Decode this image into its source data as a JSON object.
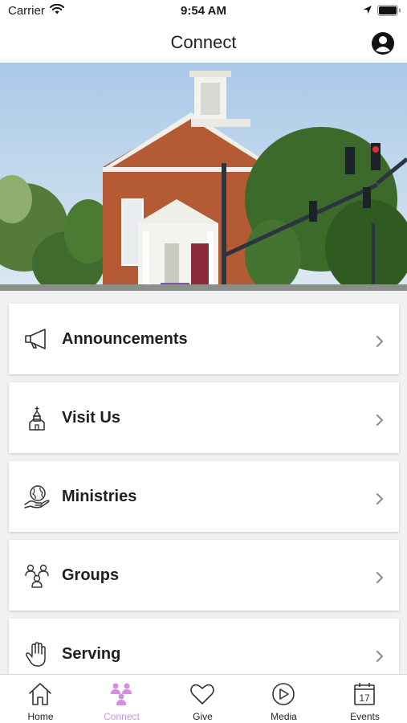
{
  "status_bar": {
    "carrier": "Carrier",
    "time": "9:54 AM"
  },
  "header": {
    "title": "Connect"
  },
  "menu": [
    {
      "label": "Announcements",
      "icon": "megaphone-icon"
    },
    {
      "label": "Visit Us",
      "icon": "church-icon"
    },
    {
      "label": "Ministries",
      "icon": "globe-hand-icon"
    },
    {
      "label": "Groups",
      "icon": "people-group-icon"
    },
    {
      "label": "Serving",
      "icon": "hand-icon"
    }
  ],
  "tabs": [
    {
      "label": "Home",
      "icon": "home-icon"
    },
    {
      "label": "Connect",
      "icon": "connect-people-icon",
      "active": true
    },
    {
      "label": "Give",
      "icon": "heart-icon"
    },
    {
      "label": "Media",
      "icon": "play-circle-icon"
    },
    {
      "label": "Events",
      "icon": "calendar-icon",
      "calendar_day": "17"
    }
  ],
  "colors": {
    "active_tab": "#d48ee0",
    "icon_stroke": "#333333"
  }
}
